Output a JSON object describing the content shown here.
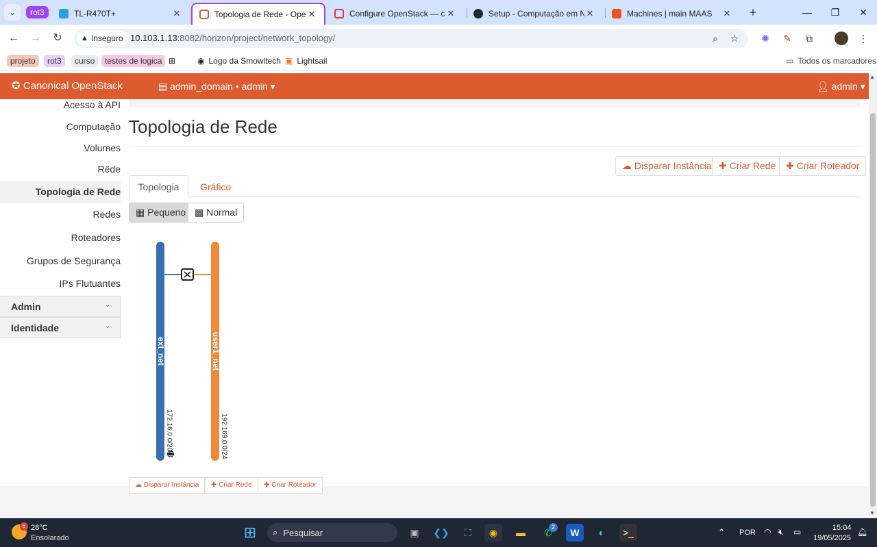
{
  "browser": {
    "group_label": "rot3",
    "tabs": [
      {
        "title": "TL-R470T+",
        "icon": "tplink-icon",
        "color": "#2ba2e0"
      },
      {
        "title": "Topologia de Rede - OpenSta",
        "icon": "openstack-icon",
        "color": "#dd5b2f"
      },
      {
        "title": "Configure OpenStack — char",
        "icon": "openstack-icon",
        "color": "#dd3b3b"
      },
      {
        "title": "Setup - Computação em Nuv",
        "icon": "github-icon",
        "color": "#24292f"
      },
      {
        "title": "Machines | main MAAS",
        "icon": "maas-icon",
        "color": "#e95420"
      }
    ],
    "security_label": "Inseguro",
    "url_host": "10.103.1.13",
    "url_rest": ":8082/horizon/project/network_topology/",
    "bookmarks": [
      {
        "label": "projeto",
        "color": "#f6c7b6"
      },
      {
        "label": "rot3",
        "color": "#e5d1fb"
      },
      {
        "label": "curso",
        "color": "#e8eaed"
      },
      {
        "label": "testes de logica",
        "color": "#f5c8e4"
      }
    ],
    "bookmark_links": [
      "Logo da Smowltech",
      "Lightsail"
    ],
    "all_bookmarks": "Todos os marcadores"
  },
  "header": {
    "logo": "Canonical OpenStack",
    "project": "admin_domain • admin",
    "user": "admin",
    "accent": "#dd5b2f"
  },
  "sidebar": {
    "items": [
      {
        "label": "Acesso à API"
      },
      {
        "label": "Computação"
      },
      {
        "label": "Volumes"
      },
      {
        "label": "Rede"
      },
      {
        "label": "Topologia de Rede"
      },
      {
        "label": "Redes"
      },
      {
        "label": "Roteadores"
      },
      {
        "label": "Grupos de Segurança"
      },
      {
        "label": "IPs Flutuantes"
      }
    ],
    "sections": [
      {
        "label": "Admin"
      },
      {
        "label": "Identidade"
      }
    ]
  },
  "main": {
    "title": "Topologia de Rede",
    "actions": {
      "launch": "Disparar Instância",
      "create_network": "Criar Rede",
      "create_router": "Criar Roteador"
    },
    "tabs": [
      "Topologia",
      "Gráfico"
    ],
    "view_toggle": [
      "Pequeno",
      "Normal"
    ],
    "networks": [
      {
        "name": "ext_net",
        "cidr": "172.16.0.0/20",
        "color": "#3a6fb0",
        "external": true
      },
      {
        "name": "user1_net",
        "cidr": "192.169.0.0/24",
        "color": "#f0883a",
        "external": false
      }
    ]
  },
  "taskbar": {
    "weather_temp": "28°C",
    "weather_desc": "Ensolarado",
    "weather_badge": "6",
    "search": "Pesquisar",
    "whatsapp_badge": "2",
    "lang": "POR",
    "time": "15:04",
    "date": "19/05/2025"
  }
}
